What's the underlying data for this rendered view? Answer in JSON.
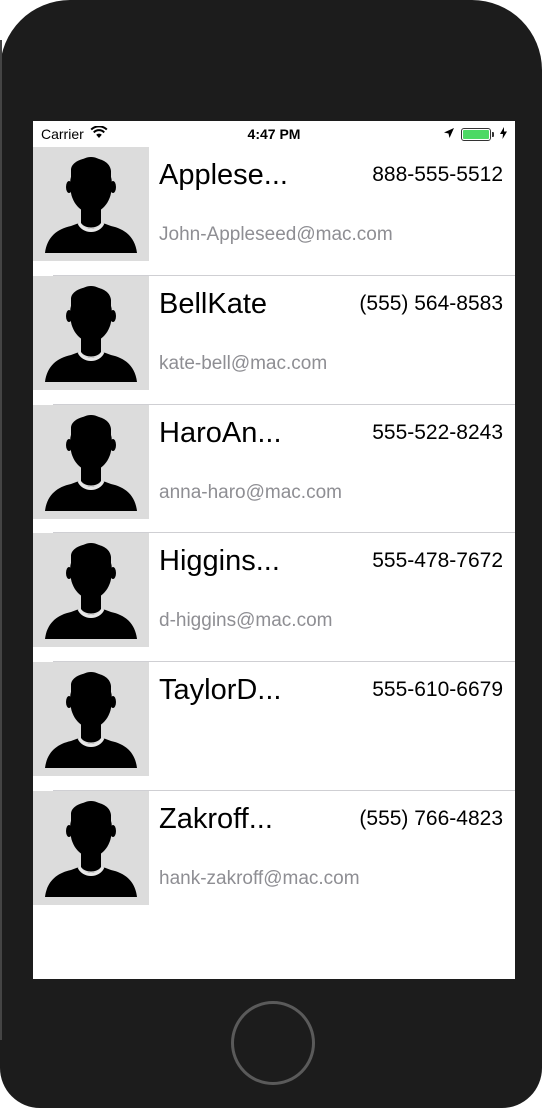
{
  "status_bar": {
    "carrier": "Carrier",
    "time": "4:47 PM",
    "battery_level": 1.0,
    "icons": [
      "wifi-icon",
      "location-arrow-icon",
      "battery-icon",
      "charging-bolt-icon"
    ]
  },
  "contacts": [
    {
      "name": "Applese...",
      "phone": "888-555-5512",
      "email": "John-Appleseed@mac.com"
    },
    {
      "name": "BellKate",
      "phone": "(555) 564-8583",
      "email": "kate-bell@mac.com"
    },
    {
      "name": "HaroAn...",
      "phone": "555-522-8243",
      "email": "anna-haro@mac.com"
    },
    {
      "name": "Higgins...",
      "phone": "555-478-7672",
      "email": "d-higgins@mac.com"
    },
    {
      "name": "TaylorD...",
      "phone": "555-610-6679",
      "email": ""
    },
    {
      "name": "Zakroff...",
      "phone": "(555) 766-4823",
      "email": "hank-zakroff@mac.com"
    }
  ],
  "colors": {
    "avatar_bg": "#dcdcdc",
    "email_text": "#8e8e93",
    "battery_fill": "#4cd964",
    "device_frame": "#1c1c1c"
  }
}
